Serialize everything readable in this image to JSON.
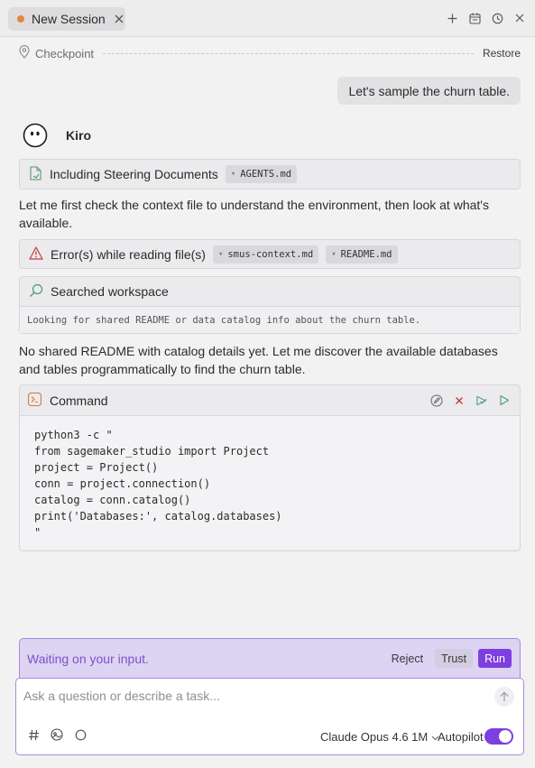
{
  "tab": {
    "title": "New Session",
    "status_color": "#e0883a"
  },
  "toolbar_icons": [
    "plus-icon",
    "calendar-icon",
    "history-icon",
    "close-icon"
  ],
  "checkpoint": {
    "label": "Checkpoint",
    "restore": "Restore"
  },
  "user_message": "Let's sample the churn table.",
  "agent": {
    "name": "Kiro"
  },
  "steering": {
    "label": "Including Steering Documents",
    "files": [
      "AGENTS.md"
    ]
  },
  "para1": "Let me first check the context file to understand the environment, then look at what's available.",
  "error": {
    "label": "Error(s) while reading file(s)",
    "files": [
      "smus-context.md",
      "README.md"
    ]
  },
  "search": {
    "label": "Searched workspace",
    "detail": "Looking for shared README or data catalog info about the churn table."
  },
  "para2": "No shared README with catalog details yet. Let me discover the available databases and tables programmatically to find the churn table.",
  "command": {
    "label": "Command",
    "code": "python3 -c \"\nfrom sagemaker_studio import Project\nproject = Project()\nconn = project.connection()\ncatalog = conn.catalog()\nprint('Databases:', catalog.databases)\n\""
  },
  "waiting": {
    "message": "Waiting on your input.",
    "reject": "Reject",
    "trust": "Trust",
    "run": "Run"
  },
  "input": {
    "placeholder": "Ask a question or describe a task...",
    "value": ""
  },
  "footer": {
    "model": "Claude Opus 4.6 1M",
    "autopilot": "Autopilot",
    "autopilot_on": true
  },
  "colors": {
    "accent": "#7d3fe0",
    "error": "#c93a3a",
    "waiting_bg": "#ddd3f3"
  }
}
